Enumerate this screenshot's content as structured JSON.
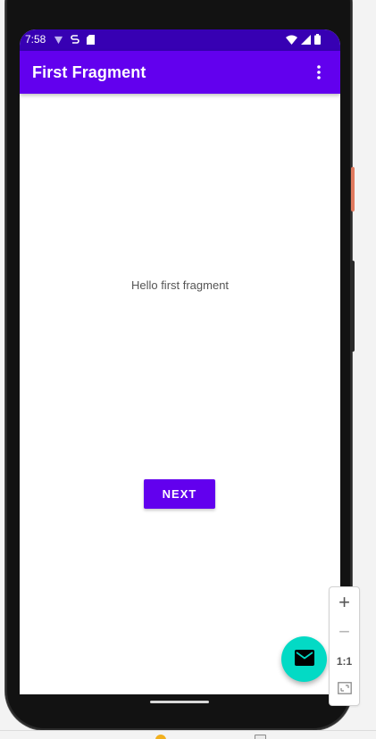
{
  "status_bar": {
    "time": "7:58",
    "icons_left": [
      "data-saver-icon",
      "sync-icon",
      "sd-card-icon"
    ],
    "icons_right": [
      "wifi-icon",
      "signal-icon",
      "battery-icon"
    ]
  },
  "app_bar": {
    "title": "First Fragment",
    "menu_icon": "more-vert-icon"
  },
  "content": {
    "message": "Hello first fragment",
    "next_label": "NEXT"
  },
  "fab": {
    "icon": "email-icon"
  },
  "zoom_controls": {
    "zoom_in": "+",
    "zoom_out": "−",
    "actual_size": "1:1",
    "fit_icon": "fit-screen-icon"
  },
  "colors": {
    "status_bar": "#3700b3",
    "primary": "#6200ee",
    "fab": "#03dac5",
    "text_secondary": "#555555"
  }
}
